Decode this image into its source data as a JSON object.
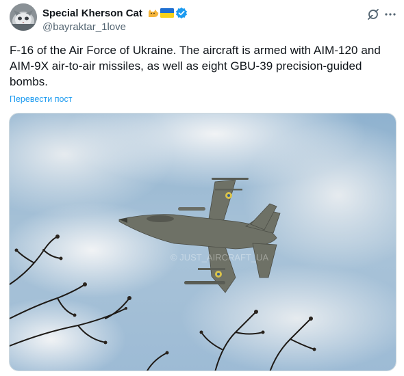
{
  "author": {
    "display_name": "Special Kherson Cat",
    "handle": "@bayraktar_1love",
    "verified": true,
    "badges": [
      "cat-emoji",
      "ukraine-flag-emoji",
      "verified-badge-icon"
    ],
    "avatar": "cat-avatar"
  },
  "actions": {
    "grok_icon": "grok-icon",
    "more_icon": "more-options-icon"
  },
  "tweet": {
    "lines": [
      "F-16 of the Air Force of Ukraine. The aircraft is armed with AIM-120 and",
      "AIM-9X air-to-air missiles, as well as eight GBU-39 precision-guided",
      "bombs."
    ],
    "translate_label": "Перевести пост"
  },
  "media": {
    "subject": "f16-fighter-jet-photo",
    "watermark": "© JUST_AIRCRAFT_UA"
  },
  "colors": {
    "text": "#0f1419",
    "secondary": "#536471",
    "accent": "#1d9bf0",
    "border": "#cfd9de"
  }
}
